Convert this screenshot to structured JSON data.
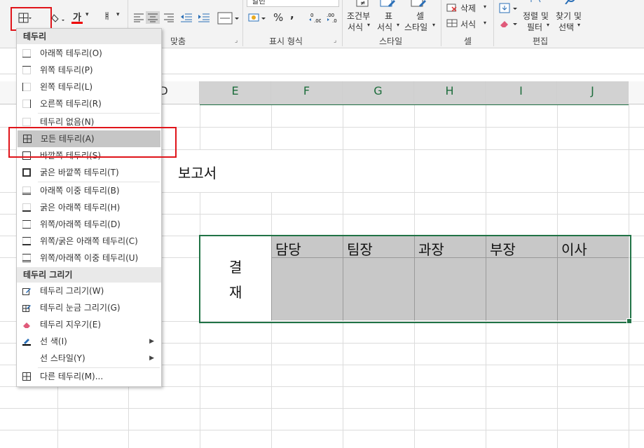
{
  "ribbon": {
    "alignment_label": "맞춤",
    "number_label": "표시 형식",
    "style_label": "스타일",
    "cells_label": "셀",
    "editing_label": "편집",
    "font_color_char": "가",
    "wrap_char": "ㅒ",
    "percent": "%",
    "comma": ",",
    "conditional_format_1": "조건부",
    "conditional_format_2": "서식",
    "table_format_1": "표",
    "table_format_2": "서식",
    "cell_style_1": "셀",
    "cell_style_2": "스타일",
    "delete_label": "삭제",
    "format_label": "서식",
    "sort_1": "정렬 및",
    "sort_2": "필터",
    "find_1": "찾기 및",
    "find_2": "선택",
    "number_format_value": "일반"
  },
  "columns": [
    "D",
    "E",
    "F",
    "G",
    "H",
    "I",
    "J"
  ],
  "sheet": {
    "report_title": "보고서",
    "approval_1": "결",
    "approval_2": "재",
    "roles": [
      "담당",
      "팀장",
      "과장",
      "부장",
      "이사"
    ]
  },
  "menu": {
    "header_borders": "테두리",
    "header_draw": "테두리 그리기",
    "items": [
      "아래쪽 테두리(O)",
      "위쪽 테두리(P)",
      "왼쪽 테두리(L)",
      "오른쪽 테두리(R)",
      "테두리 없음(N)",
      "모든 테두리(A)",
      "바깥쪽 테두리(S)",
      "굵은 바깥쪽 테두리(T)",
      "아래쪽 이중 테두리(B)",
      "굵은 아래쪽 테두리(H)",
      "위쪽/아래쪽 테두리(D)",
      "위쪽/굵은 아래쪽 테두리(C)",
      "위쪽/아래쪽 이중 테두리(U)"
    ],
    "draw_items": [
      "테두리 그리기(W)",
      "테두리 눈금 그리기(G)",
      "테두리 지우기(E)",
      "선 색(I)",
      "선 스타일(Y)",
      "다른 테두리(M)..."
    ]
  },
  "colors": {
    "accent_green": "#217346",
    "highlight_red": "#e0141a",
    "selection_gray": "#c6c6c6"
  }
}
